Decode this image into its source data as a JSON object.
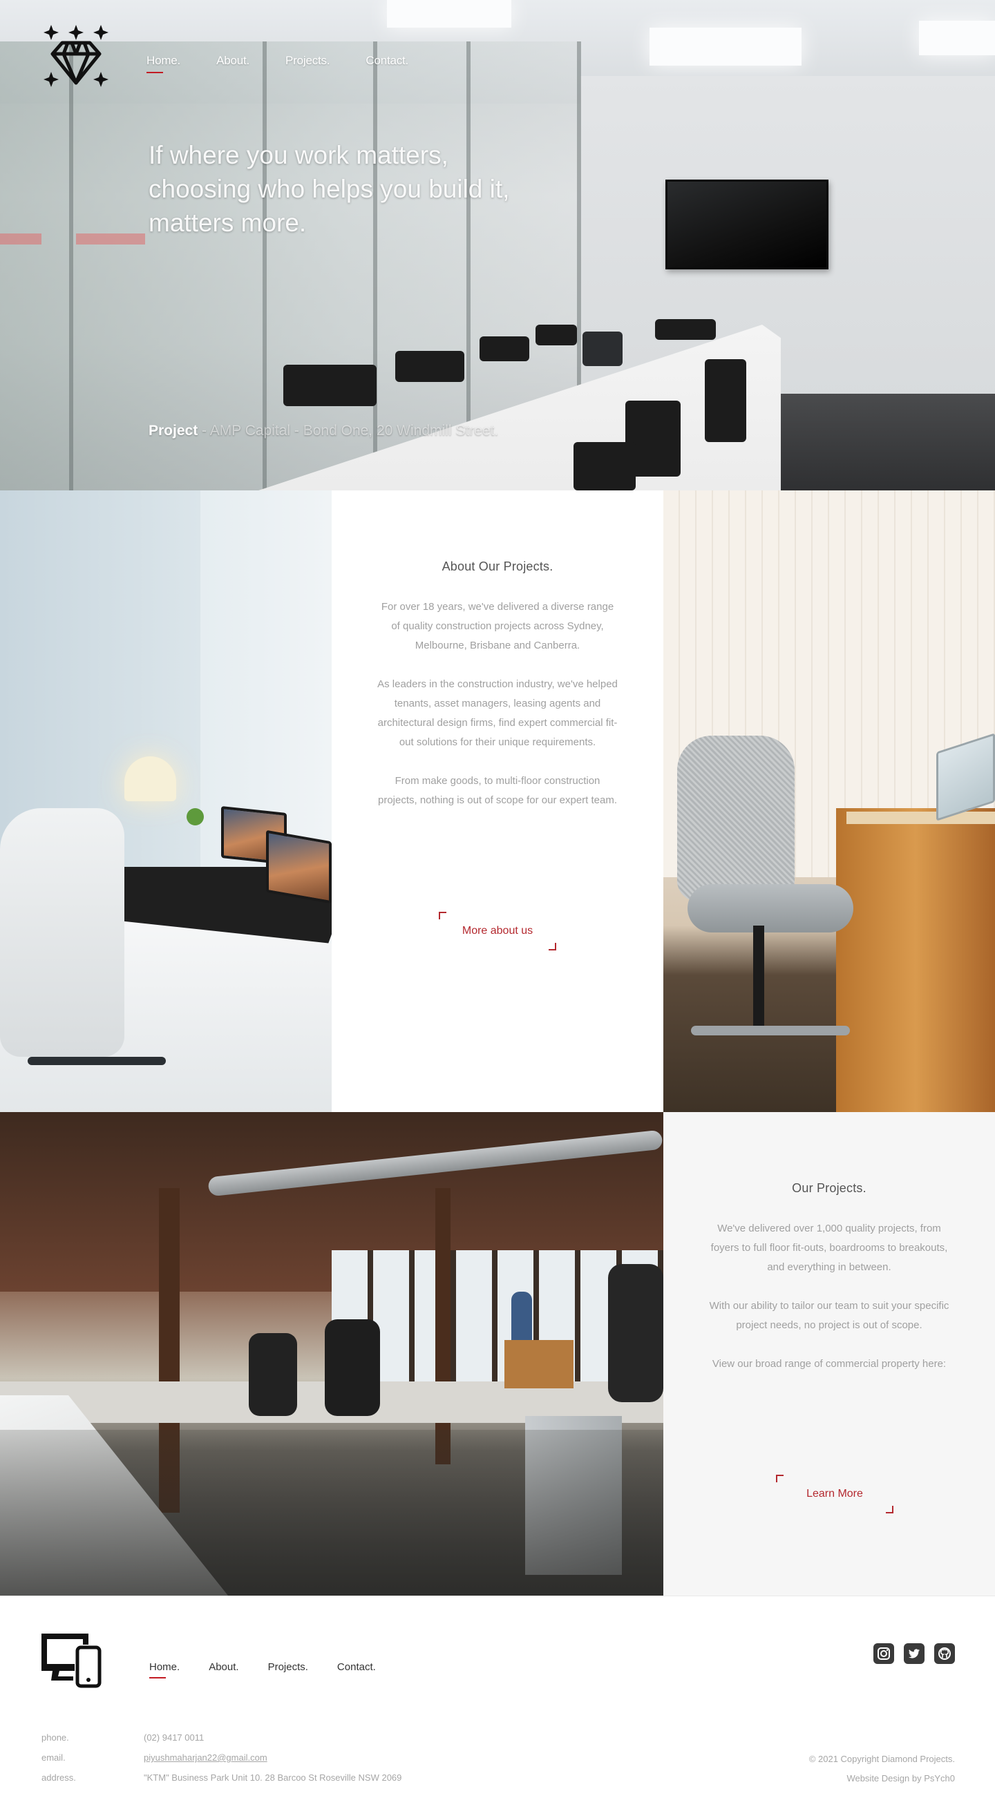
{
  "nav": {
    "home": "Home.",
    "about": "About.",
    "projects": "Projects.",
    "contact": "Contact."
  },
  "hero": {
    "title": "If where you work matters, choosing who helps you build it, matters more.",
    "project_label": "Project",
    "project_separator": "-",
    "project_detail": "AMP Capital - Bond One, 20 Windmill Street."
  },
  "about_panel": {
    "heading": "About Our Projects.",
    "paragraphs": [
      "For over 18 years, we've delivered a diverse range of quality construction projects across Sydney, Melbourne, Brisbane and Canberra.",
      "As leaders in the construction industry, we've helped tenants, asset managers, leasing agents and architectural design firms, find expert commercial fit-out solutions for their unique requirements.",
      "From make goods, to multi-floor construction projects, nothing is out of scope for our expert team."
    ],
    "button_label": "More about us"
  },
  "projects_panel": {
    "heading": "Our Projects.",
    "paragraphs": [
      "We've delivered over 1,000 quality projects, from foyers to full floor fit-outs, boardrooms to breakouts, and everything in between.",
      "With our ability to tailor our team to suit your specific project needs, no project is out of scope.",
      "View our broad range of commercial property here:"
    ],
    "button_label": "Learn More"
  },
  "footer": {
    "contact": {
      "phone_label": "phone.",
      "phone_value": "(02) 9417 0011",
      "email_label": "email.",
      "email_value": "piyushmaharjan22@gmail.com",
      "address_label": "address.",
      "address_value": "\"KTM\" Business Park Unit 10. 28 Barcoo St Roseville NSW 2069"
    },
    "copyright": "© 2021 Copyright Diamond Projects.",
    "credit": "Website Design by PsYch0",
    "social_icons": [
      "instagram-icon",
      "twitter-icon",
      "github-icon"
    ]
  },
  "colors": {
    "accent": "#c21b23",
    "button_text": "#b4292f",
    "muted_text": "#a0a0a0"
  }
}
